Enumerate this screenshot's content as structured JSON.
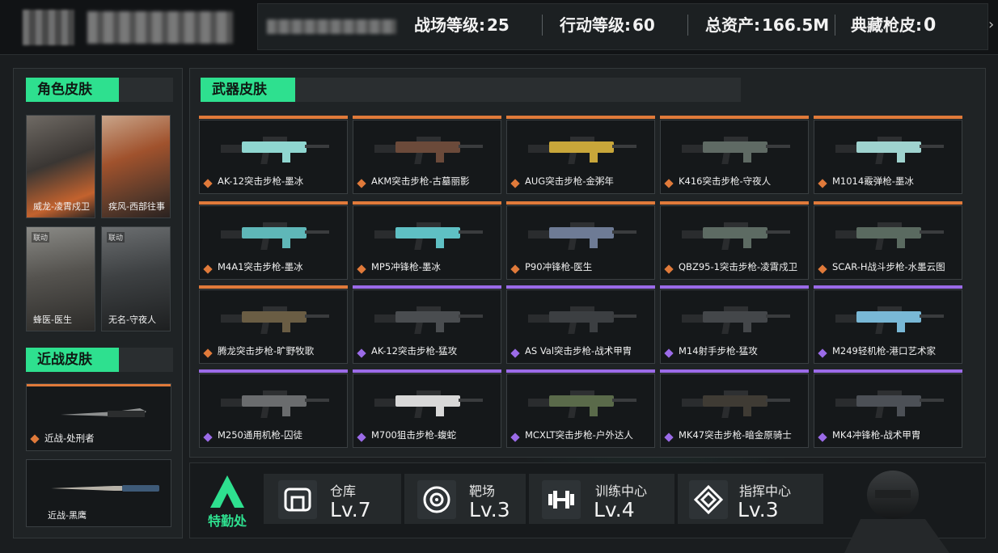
{
  "header": {
    "stats": [
      {
        "label": "战场等级:",
        "value": "25"
      },
      {
        "label": "行动等级:",
        "value": "60"
      },
      {
        "label": "总资产:",
        "value": "166.5M"
      },
      {
        "label": "典藏枪皮:",
        "value": "0"
      }
    ],
    "arrow": "›"
  },
  "sections": {
    "character": "角色皮肤",
    "melee": "近战皮肤",
    "weapon": "武器皮肤"
  },
  "character_skins": [
    {
      "label": "威龙-凌霄戍卫",
      "tag": ""
    },
    {
      "label": "疾风-西部往事",
      "tag": ""
    },
    {
      "label": "蜂医-医生",
      "tag": "联动"
    },
    {
      "label": "无名-守夜人",
      "tag": "联动"
    }
  ],
  "melee_skins": [
    {
      "label": "近战-处刑者"
    },
    {
      "label": "近战-黑鹰"
    }
  ],
  "weapon_skins": [
    {
      "label": "AK-12突击步枪-墨冰",
      "rarity": "orange"
    },
    {
      "label": "AKM突击步枪-古墓丽影",
      "rarity": "orange"
    },
    {
      "label": "AUG突击步枪-金粥年",
      "rarity": "orange"
    },
    {
      "label": "K416突击步枪-守夜人",
      "rarity": "orange"
    },
    {
      "label": "M1014霰弹枪-墨冰",
      "rarity": "orange"
    },
    {
      "label": "M4A1突击步枪-墨冰",
      "rarity": "orange"
    },
    {
      "label": "MP5冲锋枪-墨冰",
      "rarity": "orange"
    },
    {
      "label": "P90冲锋枪-医生",
      "rarity": "orange"
    },
    {
      "label": "QBZ95-1突击步枪-凌霄戍卫",
      "rarity": "orange"
    },
    {
      "label": "SCAR-H战斗步枪-水墨云图",
      "rarity": "orange"
    },
    {
      "label": "腾龙突击步枪-旷野牧歌",
      "rarity": "orange"
    },
    {
      "label": "AK-12突击步枪-猛攻",
      "rarity": "purple"
    },
    {
      "label": "AS Val突击步枪-战术甲胄",
      "rarity": "purple"
    },
    {
      "label": "M14射手步枪-猛攻",
      "rarity": "purple"
    },
    {
      "label": "M249轻机枪-港口艺术家",
      "rarity": "purple"
    },
    {
      "label": "M250通用机枪-囚徒",
      "rarity": "purple"
    },
    {
      "label": "M700狙击步枪-蝮蛇",
      "rarity": "purple"
    },
    {
      "label": "MCXLT突击步枪-户外达人",
      "rarity": "purple"
    },
    {
      "label": "MK47突击步枪-暗金原骑士",
      "rarity": "purple"
    },
    {
      "label": "MK4冲锋枪-战术甲胄",
      "rarity": "purple"
    }
  ],
  "weapon_tints": [
    "#8fd6d0",
    "#6b4a3a",
    "#c8a63a",
    "#5f6a64",
    "#9fd3cf",
    "#5fb7b8",
    "#5fc0c4",
    "#6e7b95",
    "#5d6b63",
    "#5a6a60",
    "#6a5d44",
    "#4a4d50",
    "#3c3f42",
    "#44474a",
    "#79b8d6",
    "#6a6c6e",
    "#d8d8d8",
    "#5a6a4a",
    "#3f3b34",
    "#4c5056"
  ],
  "bottom": {
    "logo_label": "特勤处",
    "facilities": [
      {
        "name": "仓库",
        "level": "Lv.7",
        "icon": "warehouse-icon"
      },
      {
        "name": "靶场",
        "level": "Lv.3",
        "icon": "target-icon"
      },
      {
        "name": "训练中心",
        "level": "Lv.4",
        "icon": "dumbbell-icon"
      },
      {
        "name": "指挥中心",
        "level": "Lv.3",
        "icon": "command-icon"
      }
    ]
  },
  "colors": {
    "accent": "#2ee08f",
    "orange": "#e07a3a",
    "purple": "#9b6be8",
    "red": "#d94545"
  }
}
